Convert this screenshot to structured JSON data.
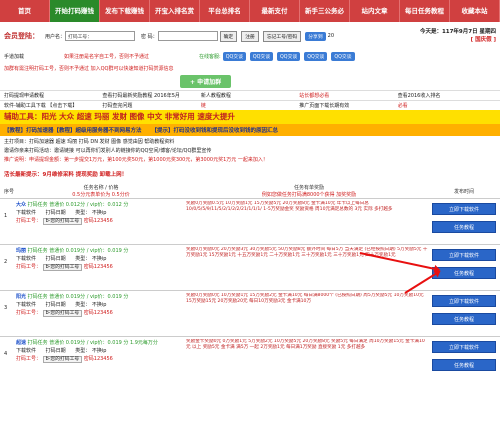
{
  "nav": [
    "首页",
    "开始打码赚钱",
    "发布下载赚钱",
    "开宝入排名赏",
    "平台总排名",
    "最新支付",
    "新手三公务必",
    "站内文章",
    "每日任务教程",
    "收藏本站"
  ],
  "login": {
    "label": "会员登陆：",
    "user_label": "用户名：",
    "user_value": "打码工号：",
    "pass_label": "密 码：",
    "login_btn": "确定",
    "register_btn": "注册",
    "forgot_btn": "忘记工号/密码",
    "share_btn": "分享到",
    "count": "20",
    "date_line1": "今天是：117年9月7日 星期四",
    "date_line2": "[ 国庆假 ]",
    "qq_label": "在线客服:",
    "qq_buttons": [
      "QQ交谈",
      "QQ交谈",
      "QQ交谈",
      "QQ交谈",
      "QQ交谈"
    ]
  },
  "notice": {
    "user_add": "手道加载",
    "warn": "如果注册是名字自工号，否则不予通过",
    "line1": "加群有需注明打码工号，否则不予通过 加入QQ群可以快速知道打码赏源信息",
    "new_btn": "+ 申请加群"
  },
  "links": [
    [
      "打码提现申请教程",
      "查看打码最新奖励教程 2016年5月",
      "新人教程教程",
      "站长都想必看",
      "查看2016收入排名"
    ],
    [
      "软件-辅助工具下载 【点击下载】",
      "打码查完问题",
      "链",
      "推广页面下载长期有效",
      "必看"
    ]
  ],
  "yellow": "辅助工具：阳光 大众 超速 玛丽 发财 图像 中文 非常好用 速度大提升",
  "orange": [
    "【教程】打码加速器【教程】超级用服务器不到网易方法",
    "【提示】打码没收到钱和提现后没收到钱的原因汇总"
  ],
  "help": {
    "line1": "主打项目：打码加速器 超速 玛丽 打码 DN 发财 图像 感觉由因 帮助教程资料",
    "line2": "邀请你亲来打码活动：邀请链接 可以再你们发别人的链接你的QQ空间/博客/论坛/QQ群里宣传",
    "line3": "推广说明：申请提现金额：第一步提交1万元，第100元奖50元，第1000元奖300元，第3000元奖1万元 一起来加入！"
  },
  "tips": "活长最新提示：9月维修采料 提现奖励 卸载上网！",
  "headers": {
    "task": "任务名称 / 价格",
    "price_note": "0.5分元表单价为 0.5分价",
    "reward": "任务有单奖励",
    "reward_note": "例如您做任务打码满8000个获得 加奖奖励",
    "publish": "发布时间"
  },
  "tasks": [
    {
      "no": "1",
      "name": "大众",
      "bonus": "打码任务 普通价 0.012分 / vip价：0.012 分",
      "dl": "下载软件",
      "dl_val": "打码日期",
      "type": "类型：",
      "type_val": "不换ip",
      "work": "打码工号：",
      "code": "b-您的打码工号",
      "pwd": "密码123456",
      "desc": "奖励0万奖励0.5元 10万奖励1元 15万奖励5元 20万奖励8元 金卡满10元 年卡以上每日总 10/0/5/5/9/11/5/2/1/2/2/21/1/1/1/ 1-5万奖励金奖 奖励资格 周10元满足总数的 3元 实际 多打越多",
      "btn1": "立即下载软件",
      "btn2": "任务教程"
    },
    {
      "no": "2",
      "name": "玛丽",
      "bonus": "打码任务 普通价 0.019分 / vip价：0.019 分",
      "dl": "下载软件",
      "dl_val": "打码日期",
      "type": "类型：",
      "type_val": "不换ip",
      "work": "打码工号：",
      "code": "b-您的打码工号",
      "pwd": "密码123456",
      "desc": "奖励0万奖励0元 20万奖励3元 30万奖励5元 50万奖励8元 额外时间 每日5万 当天满足 (已经按照日期) 5万奖励5元 十万奖励1元 15万奖励1元 十五万奖励1元 二十万奖励1元 三十万奖励1元 三十万奖励1元 四十万奖励1元",
      "btn1": "立即下载软件",
      "btn2": "任务教程"
    },
    {
      "no": "3",
      "name": "阳光",
      "bonus": "打码任务 普通价 0.019分 / vip价：0.019 分",
      "dl": "下载软件",
      "dl_val": "打码日期",
      "type": "类型：",
      "type_val": "不换ip",
      "work": "打码工号：",
      "code": "b-您的打码工号",
      "pwd": "密码123456",
      "desc": "奖励0万奖励0元 10万奖励1元 15万奖励2元 金卡满10元 每日满8000个 (已按照日期) 周5万奖励5元 10万奖励10元 15万奖励15元 20万奖励20元 每日10万奖励3元 金卡满10万",
      "btn1": "立即下载软件",
      "btn2": "任务教程"
    },
    {
      "no": "4",
      "name": "超速",
      "bonus": "打码任务 普通价 0.019分 / vip价：0.019 分 1.9元每万分",
      "dl": "下载软件",
      "dl_val": "打码日期",
      "type": "类型：",
      "type_val": "不换ip",
      "work": "打码工号：",
      "code": "b-您的打码工号",
      "pwd": "密码123456",
      "desc": "奖励金卡奖励0元 0万奖励1元 5万奖励2元 10万奖励5元 20万奖励8元 奖励5元 每日满足 周10万奖励15元 金卡满10元 以上 奖励5元 金卡满 满5万 一起 2万奖励1元 每日满1万奖励 直接奖励 1元 多打越多",
      "btn1": "立即下载软件",
      "btn2": "任务教程"
    }
  ]
}
